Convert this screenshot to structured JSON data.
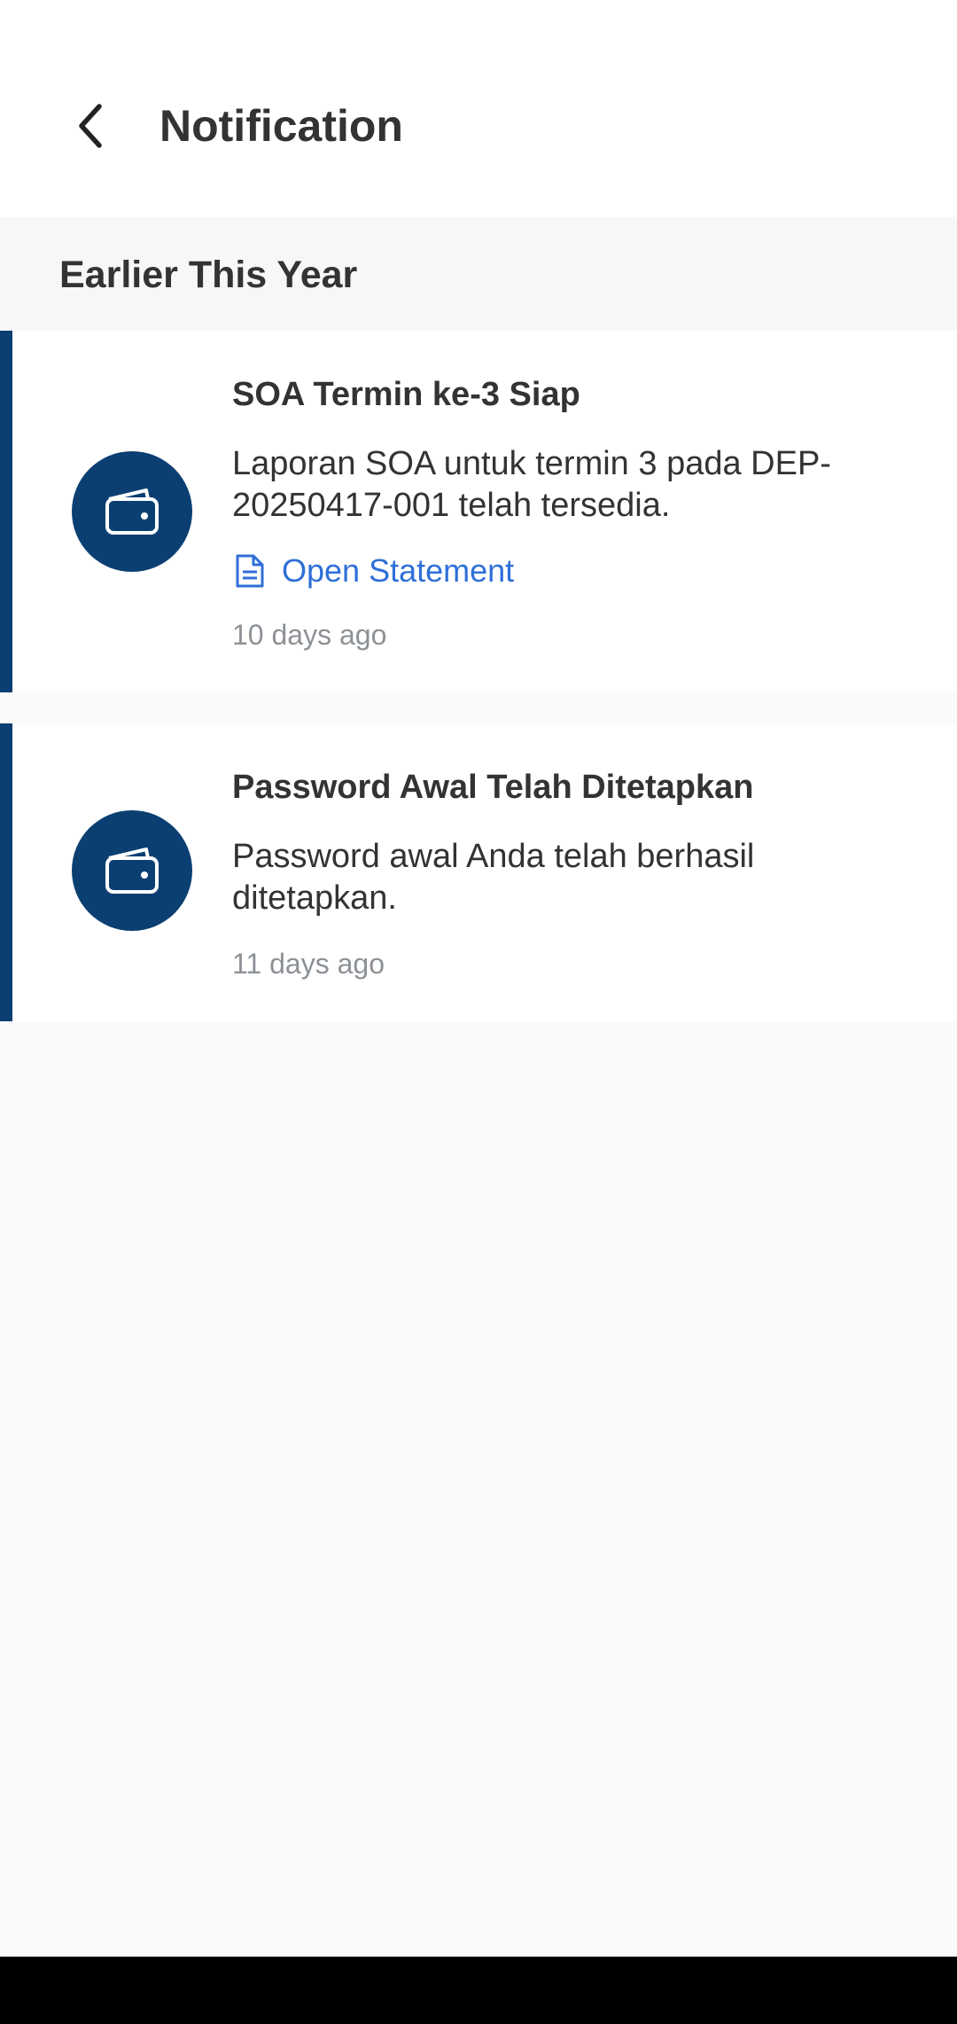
{
  "header": {
    "title": "Notification"
  },
  "section": {
    "title": "Earlier This Year"
  },
  "notifications": [
    {
      "title": "SOA Termin ke-3 Siap",
      "body": "Laporan SOA untuk termin 3 pada DEP-20250417-001 telah tersedia.",
      "link_label": "Open Statement",
      "time": "10 days ago",
      "icon": "wallet-icon"
    },
    {
      "title": "Password Awal Telah Ditetapkan",
      "body": "Password awal Anda telah berhasil ditetapkan.",
      "time": "11 days ago",
      "icon": "wallet-icon"
    }
  ],
  "colors": {
    "accent": "#0b3f72",
    "link": "#2f6fd8",
    "text": "#333333",
    "muted": "#8c9196"
  }
}
